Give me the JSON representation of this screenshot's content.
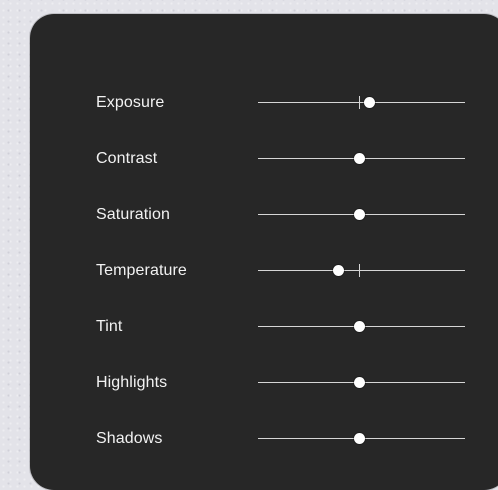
{
  "panel": {
    "sliders": [
      {
        "label": "Exposure",
        "value": 0.54,
        "default": 0.49
      },
      {
        "label": "Contrast",
        "value": 0.49,
        "default": 0.49
      },
      {
        "label": "Saturation",
        "value": 0.49,
        "default": 0.49
      },
      {
        "label": "Temperature",
        "value": 0.39,
        "default": 0.49
      },
      {
        "label": "Tint",
        "value": 0.49,
        "default": 0.49
      },
      {
        "label": "Highlights",
        "value": 0.49,
        "default": 0.49
      },
      {
        "label": "Shadows",
        "value": 0.49,
        "default": 0.49
      }
    ]
  }
}
